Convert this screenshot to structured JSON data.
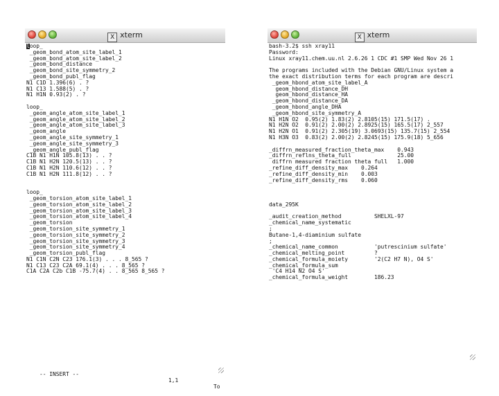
{
  "left_window": {
    "title": "xterm",
    "icon": "x11-icon",
    "lines": [
      "loop_",
      " _geom_bond_atom_site_label_1",
      " _geom_bond_atom_site_label_2",
      " _geom_bond_distance",
      " _geom_bond_site_symmetry_2",
      " _geom_bond_publ_flag",
      "N1 C1D 1.396(6) . ?",
      "N1 C13 1.588(5) . ?",
      "N1 H1N 0.93(2) . ?",
      "",
      "loop_",
      " _geom_angle_atom_site_label_1",
      " _geom_angle_atom_site_label_2",
      " _geom_angle_atom_site_label_3",
      " _geom_angle",
      " _geom_angle_site_symmetry_1",
      " _geom_angle_site_symmetry_3",
      " _geom_angle_publ_flag",
      "C1B N1 H1N 105.8(13) . . ?",
      "C1B N1 H2N 120.5(13) . . ?",
      "C1B N1 H2N 110.6(12) . . ?",
      "C1B N1 H2N 111.8(12) . . ?",
      "",
      "",
      "loop_",
      " _geom_torsion_atom_site_label_1",
      " _geom_torsion_atom_site_label_2",
      " _geom_torsion_atom_site_label_3",
      " _geom_torsion_atom_site_label_4",
      " _geom_torsion",
      " _geom_torsion_site_symmetry_1",
      " _geom_torsion_site_symmetry_2",
      " _geom_torsion_site_symmetry_3",
      " _geom_torsion_site_symmetry_4",
      " _geom_torsion_publ_flag",
      "N1 C1N C2N C23 176.1(3) . . . 8_565 ?",
      "N1 C13 C23 C2A 69.1(4) . . . 8_565 ?",
      "C1A C2A C2b C1B -75.7(4) . . 8_565 8_565 ?"
    ],
    "status_mode": "-- INSERT --",
    "status_position": "1,1",
    "status_extra": "To"
  },
  "right_window": {
    "title": "xterm",
    "icon": "x11-icon",
    "lines": [
      "bash-3.2$ ssh xray11",
      "Password:",
      "Linux xray11.chem.uu.nl 2.6.26 1 CDC #1 SMP Wed Nov 26 1",
      "",
      "The programs included with the Debian GNU/Linux system a",
      "the exact distribution terms for each program are descri",
      " _geom_hbond_atom_site_label_A",
      "  geom_hbond_distance_DH",
      "  geom_hbond_distance_HA",
      " _geom_hbond_distance_DA",
      " _geom_hbond_angle_DHA",
      " _geom_hbond_site_symmetry_A",
      "N1 H1N O2  0.95(2) 1.83(2) 2.8105(15) 171.5(17) .",
      "N1 H2N O2  0.91(2) 2.00(2) 2.8925(15) 165.5(17) 2_557",
      "N1 H2N O1  0.91(2) 2.305(19) 3.0693(15) 135.7(15) 2_554",
      "N1 H3N O3  0.83(2) 2.00(2) 2.8245(15) 175.9(18) 5_656",
      "",
      "_diffrn_measured_fraction_theta_max    0.943",
      "_diffrn_reflns_theta_full              25.00",
      " diffrn measured fraction theta full   1.000",
      "_refine_diff_density_max    0.264",
      "_refine_diff_density_min    0.003",
      "_refine_diff_density_rms    0.060",
      "",
      "",
      "",
      "data_295K",
      "",
      "_audit_creation_method          SHELXL-97",
      "_chemical_name_systematic",
      ";",
      "Butane-1,4-diaminium sulfate",
      ";",
      "_chemical_name_common           'putrescinium sulfate'",
      "_chemical_melting_point         ?",
      "_chemical_formula_moiety        '2(C2 H7 N), O4 S'",
      "_chemical_formula_sum",
      " 'C4 H14 N2 O4 S'",
      "_chemical_formula_weight        186.23"
    ]
  }
}
